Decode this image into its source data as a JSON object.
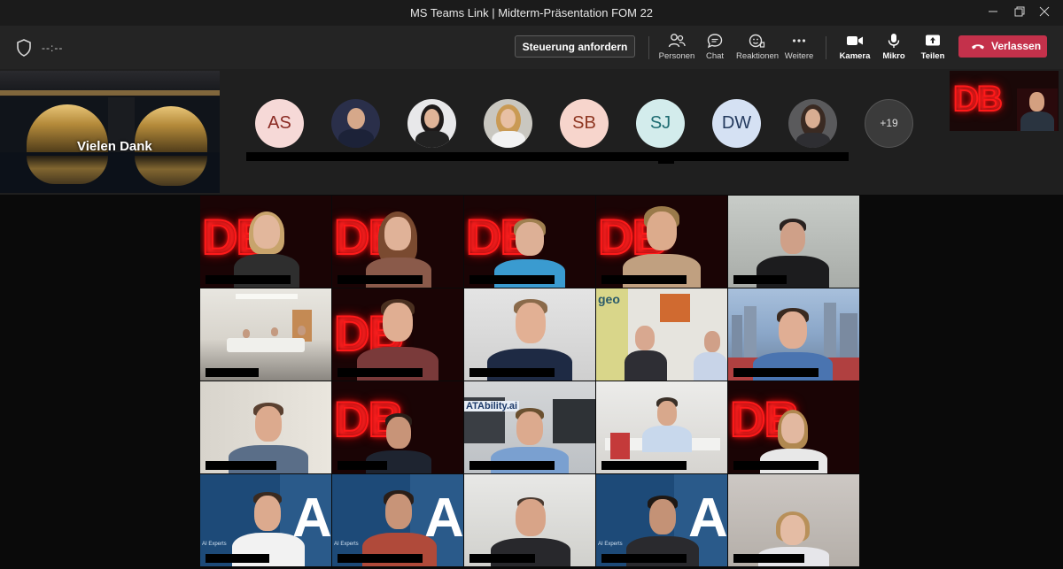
{
  "window": {
    "title": "MS Teams Link | Midterm-Präsentation FOM 22",
    "controls": [
      "minimize",
      "restore",
      "close"
    ]
  },
  "toolbar": {
    "timer": "--:--",
    "request_control_label": "Steuerung anfordern",
    "buttons": [
      {
        "label": "Personen",
        "icon": "people-icon"
      },
      {
        "label": "Chat",
        "icon": "chat-icon"
      },
      {
        "label": "Reaktionen",
        "icon": "reactions-icon"
      },
      {
        "label": "Weitere",
        "icon": "more-icon"
      },
      {
        "label": "Kamera",
        "icon": "camera-icon"
      },
      {
        "label": "Mikro",
        "icon": "mic-icon"
      },
      {
        "label": "Teilen",
        "icon": "share-icon"
      }
    ],
    "leave_label": "Verlassen",
    "leave_color": "#c4314b"
  },
  "shared_content": {
    "caption": "Vielen Dank"
  },
  "participants_strip": [
    {
      "initials": "AS",
      "bg": "#f6d9d7",
      "fg": "#8a2b24"
    },
    {
      "initials": "",
      "photo": true
    },
    {
      "initials": "",
      "photo": true
    },
    {
      "initials": "",
      "photo": true
    },
    {
      "initials": "SB",
      "bg": "#f7d5cc",
      "fg": "#8e3621"
    },
    {
      "initials": "SJ",
      "bg": "#d3ecec",
      "fg": "#1f6c72"
    },
    {
      "initials": "DW",
      "bg": "#d5e1f3",
      "fg": "#243a5e"
    },
    {
      "initials": "",
      "photo": true
    },
    {
      "initials": "+19",
      "more": true
    }
  ],
  "video_grid": {
    "rows": 4,
    "cols": 5,
    "tile_count": 20,
    "accent_sign": "DB",
    "other_sign": "ATAbility.ai",
    "other_logo_text": "AI Experts"
  },
  "colors": {
    "titlebar": "#1b1b1b",
    "toolbar": "#242424",
    "db_red": "#ff1a1a"
  }
}
